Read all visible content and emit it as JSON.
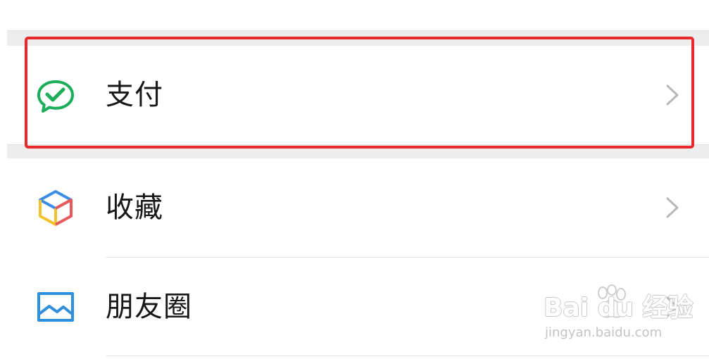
{
  "menu": {
    "items": [
      {
        "label": "支付",
        "icon": "wechat-pay-icon",
        "chevron": "chevron-right-icon"
      },
      {
        "label": "收藏",
        "icon": "favorites-cube-icon",
        "chevron": "chevron-right-icon"
      },
      {
        "label": "朋友圈",
        "icon": "moments-photo-icon",
        "chevron": "chevron-right-icon"
      }
    ]
  },
  "annotation": {
    "highlight_color": "#e8282a",
    "highlight_target": "支付"
  },
  "watermark": {
    "brand": "Bai du 经验",
    "url": "jingyan.baidu.com"
  },
  "colors": {
    "pay_green": "#1aad5a",
    "favorites_blue": "#3a8ee6",
    "favorites_yellow": "#f2c12e",
    "favorites_red": "#e85a5a",
    "moments_blue": "#2f8fdd",
    "chevron_gray": "#b8b8b8",
    "section_gap": "#ededed"
  }
}
